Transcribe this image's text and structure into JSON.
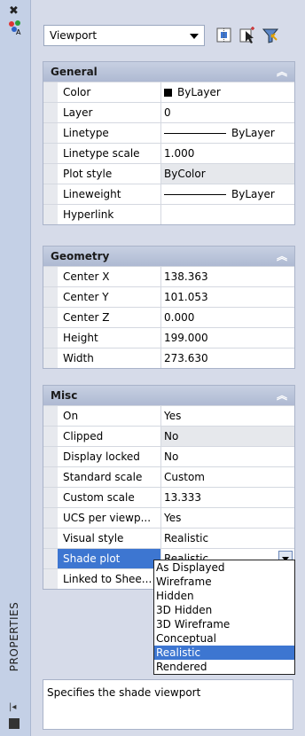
{
  "sidebar": {
    "close_glyph": "✖",
    "palette_title": "PROPERTIES",
    "auto_hide_glyph": "|◂"
  },
  "header": {
    "object_type": "Viewport"
  },
  "sections": {
    "general": {
      "title": "General",
      "rows": [
        {
          "name": "Color",
          "value": "ByLayer"
        },
        {
          "name": "Layer",
          "value": "0"
        },
        {
          "name": "Linetype",
          "value": "ByLayer"
        },
        {
          "name": "Linetype scale",
          "value": "1.000"
        },
        {
          "name": "Plot style",
          "value": "ByColor"
        },
        {
          "name": "Lineweight",
          "value": "ByLayer"
        },
        {
          "name": "Hyperlink",
          "value": ""
        }
      ]
    },
    "geometry": {
      "title": "Geometry",
      "rows": [
        {
          "name": "Center X",
          "value": "138.363"
        },
        {
          "name": "Center Y",
          "value": "101.053"
        },
        {
          "name": "Center Z",
          "value": "0.000"
        },
        {
          "name": "Height",
          "value": "199.000"
        },
        {
          "name": "Width",
          "value": "273.630"
        }
      ]
    },
    "misc": {
      "title": "Misc",
      "rows": [
        {
          "name": "On",
          "value": "Yes"
        },
        {
          "name": "Clipped",
          "value": "No"
        },
        {
          "name": "Display locked",
          "value": "No"
        },
        {
          "name": "Standard scale",
          "value": "Custom"
        },
        {
          "name": "Custom scale",
          "value": "13.333"
        },
        {
          "name": "UCS per viewp...",
          "value": "Yes"
        },
        {
          "name": "Visual style",
          "value": "Realistic"
        },
        {
          "name": "Shade plot",
          "value": "Realistic"
        },
        {
          "name": "Linked to Shee...",
          "value": ""
        }
      ]
    }
  },
  "shade_plot_dropdown": {
    "options": [
      "As Displayed",
      "Wireframe",
      "Hidden",
      "3D Hidden",
      "3D Wireframe",
      "Conceptual",
      "Realistic",
      "Rendered"
    ],
    "highlighted": "Realistic"
  },
  "description": {
    "text": "Specifies the shade viewport"
  },
  "colors": {
    "selection": "#3d76d1",
    "header": "#aeb9d2",
    "background": "#d6dbe9"
  }
}
